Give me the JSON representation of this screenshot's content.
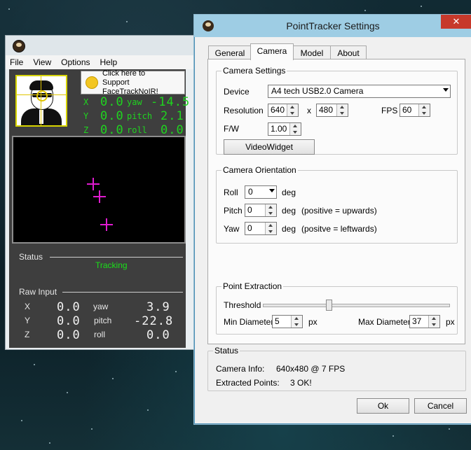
{
  "ftn": {
    "menu": [
      "File",
      "View",
      "Options",
      "Help"
    ],
    "support_line1": "Click here to",
    "support_line2": "Support FaceTrackNoIR!",
    "pose": {
      "x_label": "X",
      "y_label": "Y",
      "z_label": "Z",
      "x_val": "0.0",
      "y_val": "0.0",
      "z_val": "0.0",
      "yaw_label": "yaw",
      "pitch_label": "pitch",
      "roll_label": "roll",
      "yaw_val": "-14.5",
      "pitch_val": "2.1",
      "roll_val": "0.0"
    },
    "status_label": "Status",
    "status_value": "Tracking",
    "raw_label": "Raw Input",
    "raw": {
      "x_label": "X",
      "y_label": "Y",
      "z_label": "Z",
      "x_val": "0.0",
      "y_val": "0.0",
      "z_val": "0.0",
      "yaw_label": "yaw",
      "pitch_label": "pitch",
      "roll_label": "roll",
      "yaw_val": "3.9",
      "pitch_val": "-22.8",
      "roll_val": "0.0"
    }
  },
  "dialog": {
    "title": "PointTracker Settings",
    "close_glyph": "✕",
    "tabs": [
      "General",
      "Camera",
      "Model",
      "About"
    ],
    "active_tab": "Camera",
    "camera_settings": {
      "title": "Camera Settings",
      "device_label": "Device",
      "device_value": "A4 tech USB2.0 Camera",
      "resolution_label": "Resolution",
      "res_w": "640",
      "res_x": "x",
      "res_h": "480",
      "fps_label": "FPS",
      "fps_value": "60",
      "fw_label": "F/W",
      "fw_value": "1.00",
      "video_widget_button": "VideoWidget"
    },
    "camera_orientation": {
      "title": "Camera Orientation",
      "roll_label": "Roll",
      "roll_value": "0",
      "roll_unit": "deg",
      "pitch_label": "Pitch",
      "pitch_value": "0",
      "pitch_unit": "deg",
      "pitch_hint": "(positive = upwards)",
      "yaw_label": "Yaw",
      "yaw_value": "0",
      "yaw_unit": "deg",
      "yaw_hint": "(positve = leftwards)"
    },
    "point_extraction": {
      "title": "Point Extraction",
      "threshold_label": "Threshold",
      "threshold_fraction": 0.35,
      "min_diameter_label": "Min Diameter",
      "min_diameter_value": "5",
      "min_unit": "px",
      "max_diameter_label": "Max Diameter",
      "max_diameter_value": "37",
      "max_unit": "px"
    },
    "status": {
      "title": "Status",
      "camera_info_label": "Camera Info:",
      "camera_info_value": "640x480 @ 7 FPS",
      "extracted_label": "Extracted Points:",
      "extracted_value": "3 OK!"
    },
    "ok_button": "Ok",
    "cancel_button": "Cancel"
  }
}
